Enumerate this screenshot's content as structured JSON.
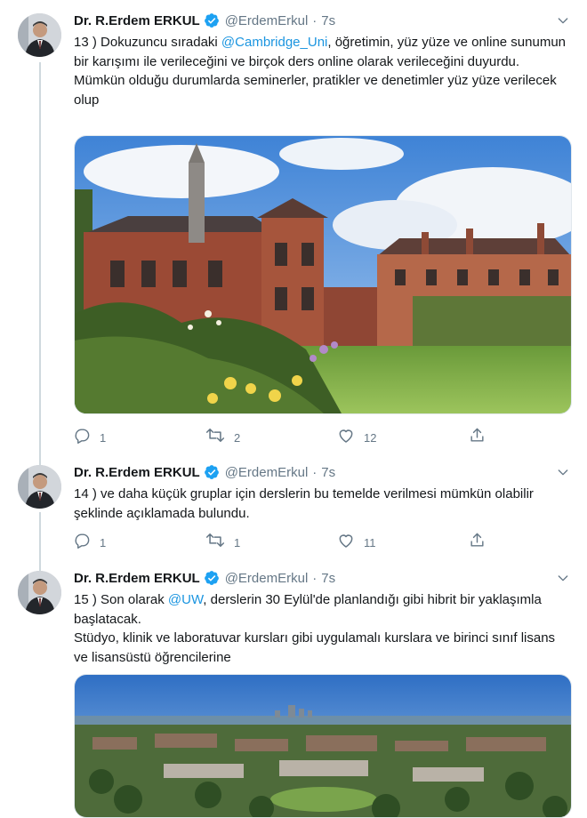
{
  "tweets": [
    {
      "author": {
        "name": "Dr. R.Erdem ERKUL",
        "handle": "@ErdemErkul",
        "verified": true
      },
      "dot": "·",
      "time": "7s",
      "text": {
        "line1_pre": "13 ) Dokuzuncu sıradaki ",
        "mention": "@Cambridge_Uni",
        "line1_post": ", öğretimin, yüz yüze ve online sunumun bir karışımı ile verileceğini ve birçok ders online olarak verileceğini duyurdu.",
        "paragraph2": "Mümkün olduğu durumlarda seminerler, pratikler ve denetimler yüz yüze verilecek olup"
      },
      "media": {
        "icon": "photo-cambridge-college"
      },
      "actions": {
        "replies": "1",
        "retweets": "2",
        "likes": "12"
      }
    },
    {
      "author": {
        "name": "Dr. R.Erdem ERKUL",
        "handle": "@ErdemErkul",
        "verified": true
      },
      "dot": "·",
      "time": "7s",
      "text": {
        "paragraph1": "14 ) ve daha küçük gruplar için derslerin bu temelde verilmesi mümkün olabilir şeklinde açıklamada bulundu."
      },
      "actions": {
        "replies": "1",
        "retweets": "1",
        "likes": "11"
      }
    },
    {
      "author": {
        "name": "Dr. R.Erdem ERKUL",
        "handle": "@ErdemErkul",
        "verified": true
      },
      "dot": "·",
      "time": "7s",
      "text": {
        "line1_pre": "15 ) Son olarak ",
        "mention": "@UW",
        "line1_post": ", derslerin 30 Eylül'de planlandığı gibi hibrit bir yaklaşımla başlatacak.",
        "paragraph2": "Stüdyo, klinik ve laboratuvar kursları gibi uygulamalı kurslara ve birinci sınıf lisans ve lisansüstü öğrencilerine"
      },
      "media": {
        "icon": "photo-uw-campus-aerial"
      }
    }
  ],
  "colors": {
    "accent": "#1b95e0",
    "secondary_text": "#657786",
    "divider": "#e6ecf0",
    "like": "#e0245e"
  }
}
